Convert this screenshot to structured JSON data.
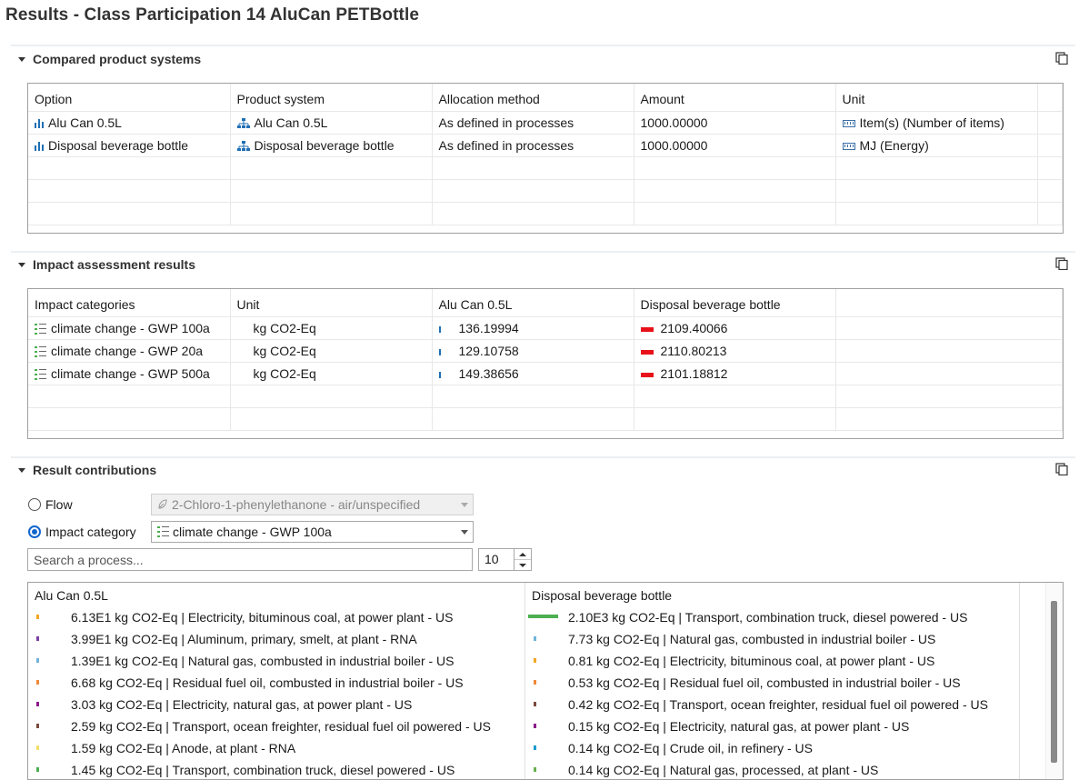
{
  "title": "Results - Class Participation 14 AluCan PETBottle",
  "compared": {
    "heading": "Compared product systems",
    "columns": [
      "Option",
      "Product system",
      "Allocation method",
      "Amount",
      "Unit"
    ],
    "rows": [
      {
        "option": "Alu Can 0.5L",
        "system": "Alu Can 0.5L",
        "allocation": "As defined in processes",
        "amount": "1000.00000",
        "unit": "Item(s) (Number of items)"
      },
      {
        "option": "Disposal beverage bottle",
        "system": "Disposal beverage bottle",
        "allocation": "As defined in processes",
        "amount": "1000.00000",
        "unit": "MJ (Energy)"
      }
    ]
  },
  "impact": {
    "heading": "Impact assessment results",
    "columns": [
      "Impact categories",
      "Unit",
      "Alu Can 0.5L",
      "Disposal beverage bottle"
    ],
    "rows": [
      {
        "category": "climate change - GWP 100a",
        "unit": "kg CO2-Eq",
        "alu": "136.19994",
        "alu_share": 0.06,
        "disp": "2109.40066",
        "disp_share": 1.0
      },
      {
        "category": "climate change - GWP 20a",
        "unit": "kg CO2-Eq",
        "alu": "129.10758",
        "alu_share": 0.06,
        "disp": "2110.80213",
        "disp_share": 1.0
      },
      {
        "category": "climate change - GWP 500a",
        "unit": "kg CO2-Eq",
        "alu": "149.38656",
        "alu_share": 0.07,
        "disp": "2101.18812",
        "disp_share": 1.0
      }
    ],
    "bar_color": "#e8111a",
    "small_bar_color": "#1f6fb5"
  },
  "contributions": {
    "heading": "Result contributions",
    "flow_label": "Flow",
    "flow_value": "2-Chloro-1-phenylethanone - air/unspecified",
    "category_label": "Impact category",
    "category_value": "climate change - GWP 100a",
    "selected_mode": "Impact category",
    "search_placeholder": "Search a process...",
    "count": "10",
    "columns": [
      "Alu Can 0.5L",
      "Disposal beverage bottle"
    ],
    "alu": [
      {
        "text": "6.13E1 kg CO2-Eq | Electricity, bituminous coal, at power plant - US",
        "color": "#f5a623"
      },
      {
        "text": "3.99E1 kg CO2-Eq | Aluminum, primary, smelt, at plant - RNA",
        "color": "#7b3fa0"
      },
      {
        "text": "1.39E1 kg CO2-Eq | Natural gas, combusted in industrial boiler - US",
        "color": "#6fb4d8"
      },
      {
        "text": "6.68 kg CO2-Eq | Residual fuel oil, combusted in industrial boiler - US",
        "color": "#ef8a3a"
      },
      {
        "text": "3.03 kg CO2-Eq | Electricity, natural gas, at power plant - US",
        "color": "#8b1a8b"
      },
      {
        "text": "2.59 kg CO2-Eq | Transport, ocean freighter, residual fuel oil powered - US",
        "color": "#7a4b3a"
      },
      {
        "text": "1.59 kg CO2-Eq | Anode, at plant - RNA",
        "color": "#f2e06a"
      },
      {
        "text": "1.45 kg CO2-Eq | Transport, combination truck, diesel powered - US",
        "color": "#4caf50"
      }
    ],
    "disp": [
      {
        "text": "2.10E3 kg CO2-Eq | Transport, combination truck, diesel powered - US",
        "color": "#4caf50",
        "share": 1.0
      },
      {
        "text": "7.73 kg CO2-Eq | Natural gas, combusted in industrial boiler - US",
        "color": "#6fb4d8",
        "share": 0.0
      },
      {
        "text": "0.81 kg CO2-Eq | Electricity, bituminous coal, at power plant - US",
        "color": "#f5a623",
        "share": 0.0
      },
      {
        "text": "0.53 kg CO2-Eq | Residual fuel oil, combusted in industrial boiler - US",
        "color": "#ef8a3a",
        "share": 0.0
      },
      {
        "text": "0.42 kg CO2-Eq | Transport, ocean freighter, residual fuel oil powered - US",
        "color": "#7a4b3a",
        "share": 0.0
      },
      {
        "text": "0.15 kg CO2-Eq | Electricity, natural gas, at power plant - US",
        "color": "#8b1a8b",
        "share": 0.0
      },
      {
        "text": "0.14 kg CO2-Eq | Crude oil, in refinery - US",
        "color": "#1a9bd1",
        "share": 0.0
      },
      {
        "text": "0.14 kg CO2-Eq | Natural gas, processed, at plant - US",
        "color": "#6ab04c",
        "share": 0.0
      }
    ]
  }
}
